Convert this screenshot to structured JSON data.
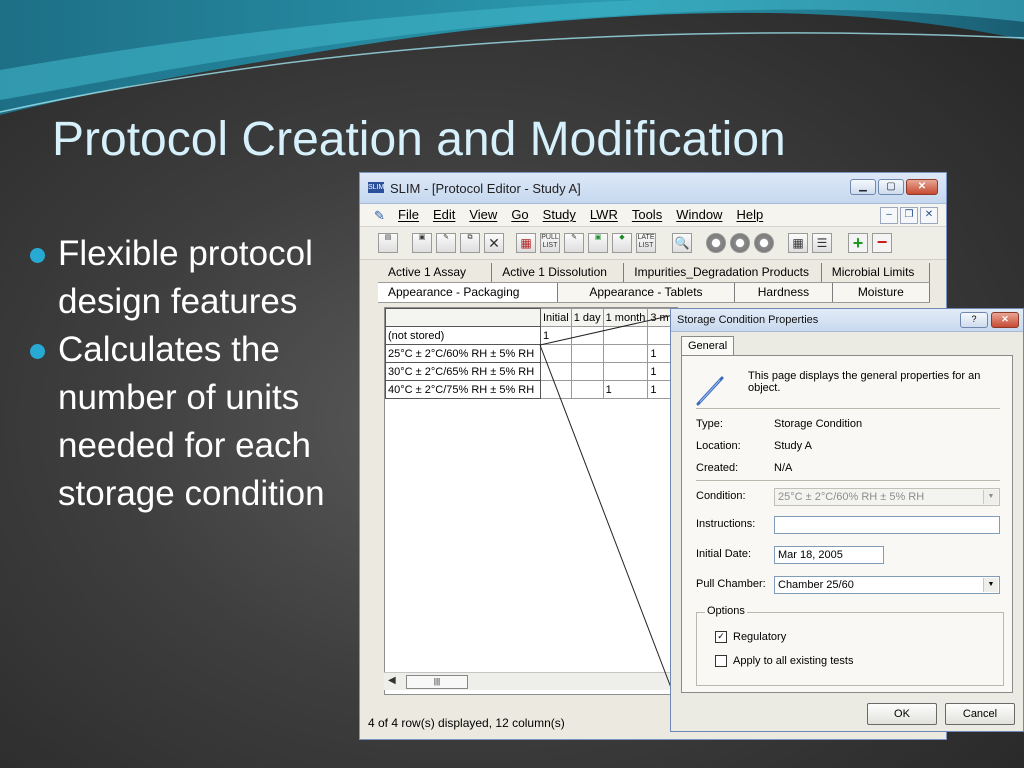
{
  "slide": {
    "title": "Protocol Creation and Modification",
    "bullets": [
      "Flexible protocol design features",
      "Calculates the number of units needed for each storage condition"
    ]
  },
  "window": {
    "title": "SLIM - [Protocol Editor - Study A]",
    "app_icon_text": "SLIM",
    "menu": [
      "File",
      "Edit",
      "View",
      "Go",
      "Study",
      "LWR",
      "Tools",
      "Window",
      "Help"
    ],
    "toolbar": {
      "pull_list": "PULL LIST",
      "late_list": "LATE LIST"
    },
    "tabs_row1": [
      "Active 1 Assay",
      "Active 1 Dissolution",
      "Impurities_Degradation Products",
      "Microbial Limits"
    ],
    "tabs_row2": [
      "Appearance - Packaging",
      "Appearance - Tablets",
      "Hardness",
      "Moisture"
    ],
    "grid": {
      "columns": [
        "",
        "Initial",
        "1 day",
        "1 month",
        "3 m"
      ],
      "rows": [
        {
          "label": "(not stored)",
          "cells": [
            "1",
            "",
            "",
            ""
          ]
        },
        {
          "label": "25°C ± 2°C/60% RH ± 5% RH",
          "cells": [
            "",
            "",
            "",
            "1"
          ]
        },
        {
          "label": "30°C ± 2°C/65% RH ± 5% RH",
          "cells": [
            "",
            "",
            "",
            "1"
          ]
        },
        {
          "label": "40°C ± 2°C/75% RH ± 5% RH",
          "cells": [
            "",
            "",
            "1",
            "1"
          ]
        }
      ]
    },
    "status": "4 of 4 row(s) displayed, 12 column(s)"
  },
  "dialog": {
    "title": "Storage Condition Properties",
    "help_button": "?",
    "tab": "General",
    "description": "This page displays the general properties for an object.",
    "type_label": "Type:",
    "type_value": "Storage Condition",
    "location_label": "Location:",
    "location_value": "Study A",
    "created_label": "Created:",
    "created_value": "N/A",
    "condition_label": "Condition:",
    "condition_value": "25°C ± 2°C/60% RH ± 5% RH",
    "instructions_label": "Instructions:",
    "instructions_value": "",
    "initial_date_label": "Initial Date:",
    "initial_date_value": "Mar 18, 2005",
    "pull_chamber_label": "Pull Chamber:",
    "pull_chamber_value": "Chamber 25/60",
    "options_legend": "Options",
    "regulatory_label": "Regulatory",
    "regulatory_checked": true,
    "apply_all_label": "Apply to all existing tests",
    "apply_all_checked": false,
    "ok_label": "OK",
    "cancel_label": "Cancel"
  }
}
